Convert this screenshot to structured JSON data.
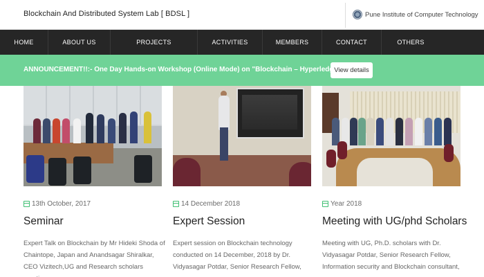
{
  "header": {
    "site_title": "Blockchain And Distributed System Lab [ BDSL ]",
    "institute": "Pune Institute of Computer Technology"
  },
  "nav": {
    "items": [
      "HOME",
      "ABOUT US",
      "PROJECTS",
      "ACTIVITIES",
      "MEMBERS",
      "CONTACT",
      "OTHERS"
    ]
  },
  "announcement": {
    "text": "ANNOUNCEMENT!!:- One Day Hands-on Workshop (Online Mode) on \"Blockchain – Hyperledger Fabric\"",
    "button_label": "View details"
  },
  "cards": [
    {
      "date": "13th October, 2017",
      "title": "Seminar",
      "text": "Expert Talk on Blockchain by Mr Hideki Shoda of Chaintope, Japan and Anandsagar Shiralkar, CEO Vizitech,UG and Research scholars meeting"
    },
    {
      "date": "14 December 2018",
      "title": "Expert Session",
      "text": "Expert session on Blockchain technology conducted on 14 December, 2018 by Dr. Vidyasagar Potdar, Senior Research Fellow,"
    },
    {
      "date": "Year 2018",
      "title": "Meeting with UG/phd Scholars",
      "text": "Meeting with UG, Ph.D. scholars with Dr. Vidyasagar Potdar, Senior Research Fellow, Information security and Blockchain consultant,"
    }
  ],
  "colors": {
    "nav_bg": "#262626",
    "announcement_bg": "#6fd397",
    "accent_green": "#3fbf72"
  }
}
